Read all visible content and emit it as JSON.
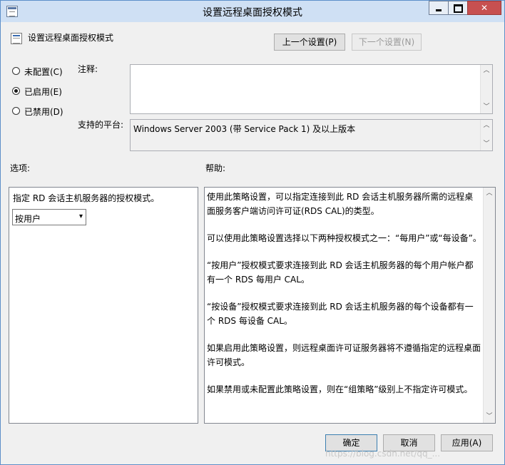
{
  "window": {
    "title": "设置远程桌面授权模式",
    "icon": "policy-window-icon"
  },
  "policy": {
    "name": "设置远程桌面授权模式",
    "icon": "policy-setting-icon",
    "prev_button": "上一个设置(P)",
    "next_button": "下一个设置(N)"
  },
  "state": {
    "options": [
      {
        "label": "未配置(C)",
        "selected": false
      },
      {
        "label": "已启用(E)",
        "selected": true
      },
      {
        "label": "已禁用(D)",
        "selected": false
      }
    ]
  },
  "comment": {
    "label": "注释:",
    "value": ""
  },
  "platform": {
    "label": "支持的平台:",
    "value": "Windows Server 2003 (带 Service Pack 1) 及以上版本"
  },
  "options_section": {
    "label": "选项:",
    "description": "指定 RD 会话主机服务器的授权模式。",
    "mode_select": {
      "selected": "按用户"
    }
  },
  "help_section": {
    "label": "帮助:",
    "paragraphs": [
      "使用此策略设置，可以指定连接到此 RD 会话主机服务器所需的远程桌面服务客户端访问许可证(RDS CAL)的类型。",
      "可以使用此策略设置选择以下两种授权模式之一：“每用户”或“每设备”。",
      "“按用户”授权模式要求连接到此 RD 会话主机服务器的每个用户帐户都有一个 RDS 每用户 CAL。",
      "“按设备”授权模式要求连接到此 RD 会话主机服务器的每个设备都有一个 RDS 每设备 CAL。",
      "如果启用此策略设置，则远程桌面许可证服务器将不遵循指定的远程桌面许可模式。",
      "如果禁用或未配置此策略设置，则在“组策略”级别上不指定许可模式。"
    ]
  },
  "footer": {
    "ok": "确定",
    "cancel": "取消",
    "apply": "应用(A)"
  },
  "watermark": "https://blog.csdn.net/qq_..."
}
